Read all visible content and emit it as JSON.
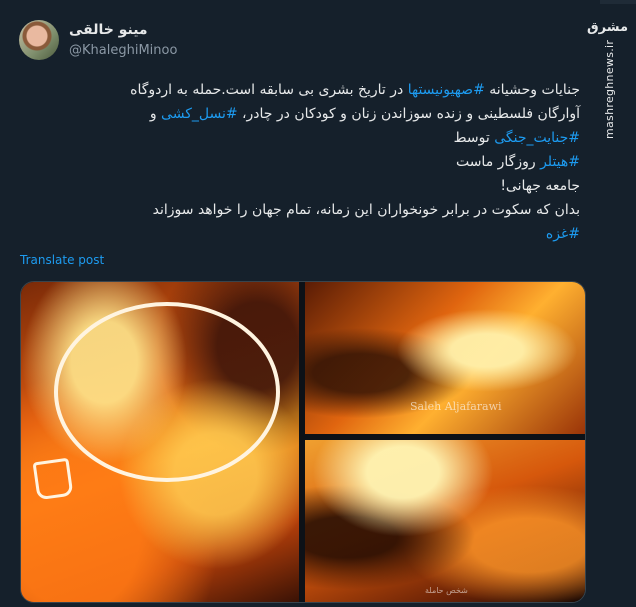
{
  "author": {
    "name": "مینو خالقی",
    "handle": "@KhaleghiMinoo"
  },
  "tweet": {
    "line1_pre": "جنایات وحشیانه ",
    "line1_tag": "#صهیونیستها",
    "line1_post": " در تاریخ بشری بی سابقه است.حمله به اردوگاه",
    "line2_pre": "آوارگان فلسطینی و زنده سوزاندن زنان و کودکان در چادر، ",
    "line2_tag": "#نسل_کشی",
    "line2_post": " و",
    "line3_tag": "#جنایت_جنگی",
    "line3_post": " توسط",
    "line4_tag": "#هیتلر",
    "line4_post": " روزگار ماست",
    "line5": "جامعه جهانی!",
    "line6": "بدان که سکوت در برابر خونخواران این زمانه، تمام جهان را خواهد سوزاند",
    "line7_tag": "#غزه"
  },
  "translate_label": "Translate post",
  "media": {
    "watermark": "Saleh Aljafarawi",
    "sub_caption": "شخص حاملة"
  },
  "brand": {
    "logo": "مشرق",
    "url": "mashreghnews.ir"
  }
}
